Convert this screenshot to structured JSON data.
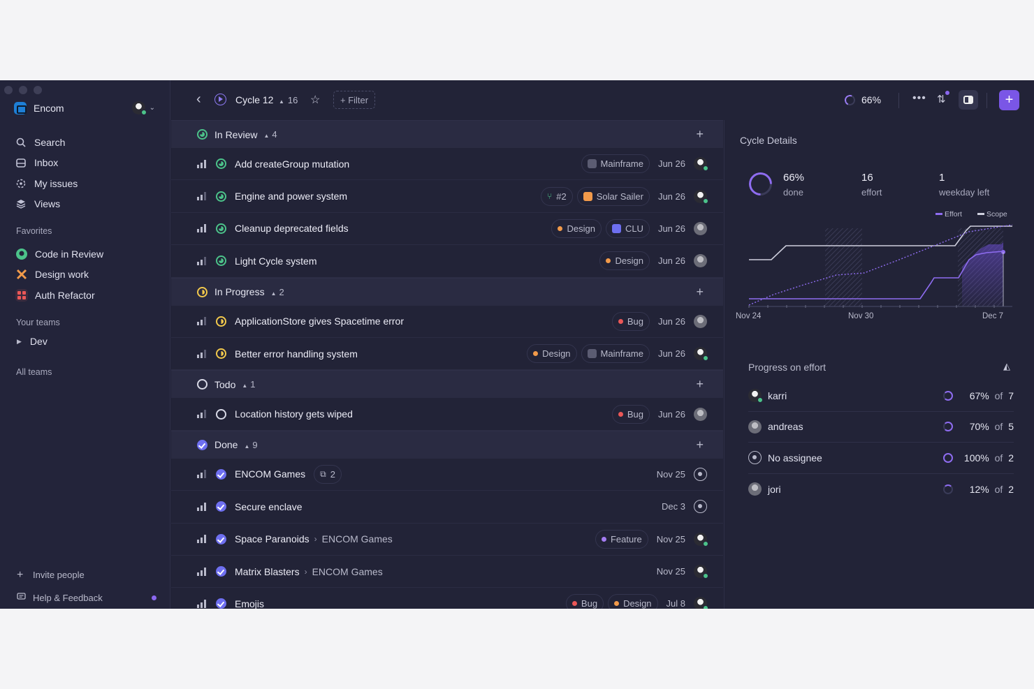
{
  "workspace": {
    "name": "Encom"
  },
  "nav": [
    {
      "label": "Search",
      "icon": "search-icon"
    },
    {
      "label": "Inbox",
      "icon": "inbox-icon"
    },
    {
      "label": "My issues",
      "icon": "my-issues-icon"
    },
    {
      "label": "Views",
      "icon": "views-icon"
    }
  ],
  "favorites": {
    "label": "Favorites",
    "items": [
      {
        "label": "Code in Review",
        "icon": "github-icon"
      },
      {
        "label": "Design work",
        "icon": "tools-icon"
      },
      {
        "label": "Auth Refactor",
        "icon": "grid-icon"
      }
    ]
  },
  "teams": {
    "label": "Your teams",
    "item": "Dev",
    "all": "All teams"
  },
  "bottom": {
    "invite": "Invite people",
    "help": "Help & Feedback"
  },
  "topbar": {
    "title": "Cycle 12",
    "count": "16",
    "filter": "+ Filter",
    "progress": "66%",
    "add": "+"
  },
  "groups": {
    "review": {
      "label": "In Review",
      "count": "4"
    },
    "progress": {
      "label": "In Progress",
      "count": "2"
    },
    "todo": {
      "label": "Todo",
      "count": "1"
    },
    "done": {
      "label": "Done",
      "count": "9"
    }
  },
  "issues": [
    {
      "title": "Add createGroup mutation",
      "chips": [
        "Mainframe"
      ],
      "date": "Jun 26"
    },
    {
      "title": "Engine and power system",
      "chips": [
        "#2",
        "Solar Sailer"
      ],
      "date": "Jun 26"
    },
    {
      "title": "Cleanup deprecated fields",
      "chips": [
        "Design",
        "CLU"
      ],
      "date": "Jun 26"
    },
    {
      "title": "Light Cycle system",
      "chips": [
        "Design"
      ],
      "date": "Jun 26"
    },
    {
      "title": "ApplicationStore gives Spacetime error",
      "chips": [
        "Bug"
      ],
      "date": "Jun 26"
    },
    {
      "title": "Better error handling system",
      "chips": [
        "Design",
        "Mainframe"
      ],
      "date": "Jun 26"
    },
    {
      "title": "Location history gets wiped",
      "chips": [
        "Bug"
      ],
      "date": "Jun 26"
    },
    {
      "title": "ENCOM Games",
      "chips": [
        "2"
      ],
      "date": "Nov 25"
    },
    {
      "title": "Secure enclave",
      "chips": [],
      "date": "Dec 3"
    },
    {
      "title": "Space Paranoids",
      "parent": "ENCOM Games",
      "chips": [
        "Feature"
      ],
      "date": "Nov 25"
    },
    {
      "title": "Matrix Blasters",
      "parent": "ENCOM Games",
      "chips": [],
      "date": "Nov 25"
    },
    {
      "title": "Emojis",
      "chips": [
        "Bug",
        "Design"
      ],
      "date": "Jul 8"
    }
  ],
  "colors": {
    "design": "#f29a4a",
    "bug": "#eb5757",
    "feature": "#a47cf2",
    "accent": "#7a56e6",
    "review": "#4cc38a",
    "progress": "#f2c94c"
  },
  "details": {
    "title": "Cycle Details",
    "done": {
      "value": "66%",
      "label": "done"
    },
    "effort": {
      "value": "16",
      "label": "effort"
    },
    "weekday": {
      "value": "1",
      "label": "weekday left"
    },
    "progress_title": "Progress on effort"
  },
  "chart_data": {
    "type": "line",
    "x_ticks": [
      "Nov 24",
      "Nov 30",
      "Dec 7"
    ],
    "legend": [
      "Effort",
      "Scope"
    ],
    "legend_position": "top-right"
  },
  "assignees": [
    {
      "name": "karri",
      "pct": "67%",
      "of": "of",
      "total": "7",
      "progress": 0.67
    },
    {
      "name": "andreas",
      "pct": "70%",
      "of": "of",
      "total": "5",
      "progress": 0.7
    },
    {
      "name": "No assignee",
      "pct": "100%",
      "of": "of",
      "total": "2",
      "progress": 1.0
    },
    {
      "name": "jori",
      "pct": "12%",
      "of": "of",
      "total": "2",
      "progress": 0.12
    }
  ]
}
